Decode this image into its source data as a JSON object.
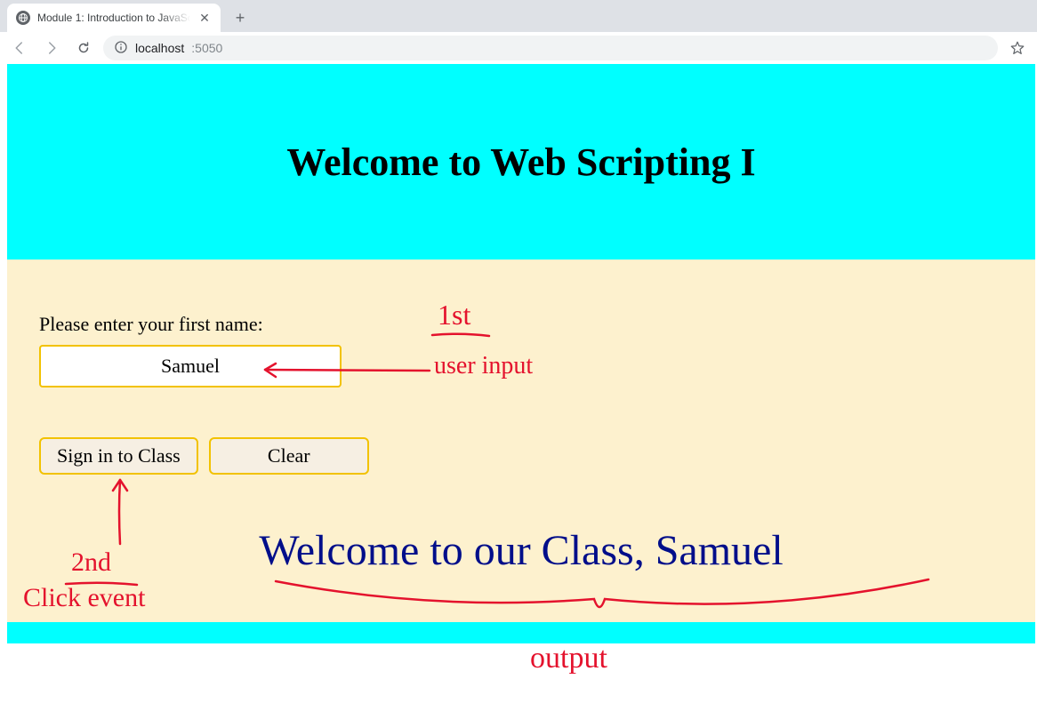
{
  "browser": {
    "tab_title": "Module 1: Introduction to JavaSc",
    "url_host": "localhost",
    "url_port": ":5050"
  },
  "page": {
    "heading": "Welcome to Web Scripting I",
    "prompt": "Please enter your first name:",
    "input_value": "Samuel",
    "signin_label": "Sign in to Class",
    "clear_label": "Clear",
    "output": "Welcome to our Class, Samuel"
  },
  "annotations": {
    "first": "1st",
    "user_input": "user input",
    "second": "2nd",
    "click_event": "Click event",
    "output": "output"
  }
}
